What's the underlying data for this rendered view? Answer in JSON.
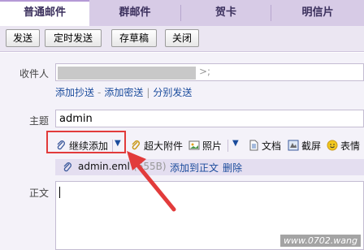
{
  "tabs": [
    {
      "label": "普通邮件",
      "active": true
    },
    {
      "label": "群邮件",
      "active": false
    },
    {
      "label": "贺卡",
      "active": false
    },
    {
      "label": "明信片",
      "active": false
    }
  ],
  "toolbar": {
    "send": "发送",
    "scheduled": "定时发送",
    "draft": "存草稿",
    "close": "关闭"
  },
  "compose": {
    "to_label": "收件人",
    "to_suffix": ">;",
    "add_cc": "添加抄送",
    "add_bcc": "添加密送",
    "separate": "分别发送",
    "subject_label": "主题",
    "subject_value": "admin",
    "body_label": "正文"
  },
  "attach_bar": {
    "continue_add": "继续添加",
    "large_attach": "超大附件",
    "photo": "照片",
    "document": "文档",
    "screenshot": "截屏",
    "emoji": "表情"
  },
  "attachment": {
    "name": "admin.eml",
    "size": "(655B)",
    "add_to_body": "添加到正文",
    "delete": "删除"
  },
  "watermark": "www.0702.wang",
  "colors": {
    "tab_bar": "#d7cbe6",
    "link": "#1a4b9c",
    "highlight": "#e23b3b"
  }
}
